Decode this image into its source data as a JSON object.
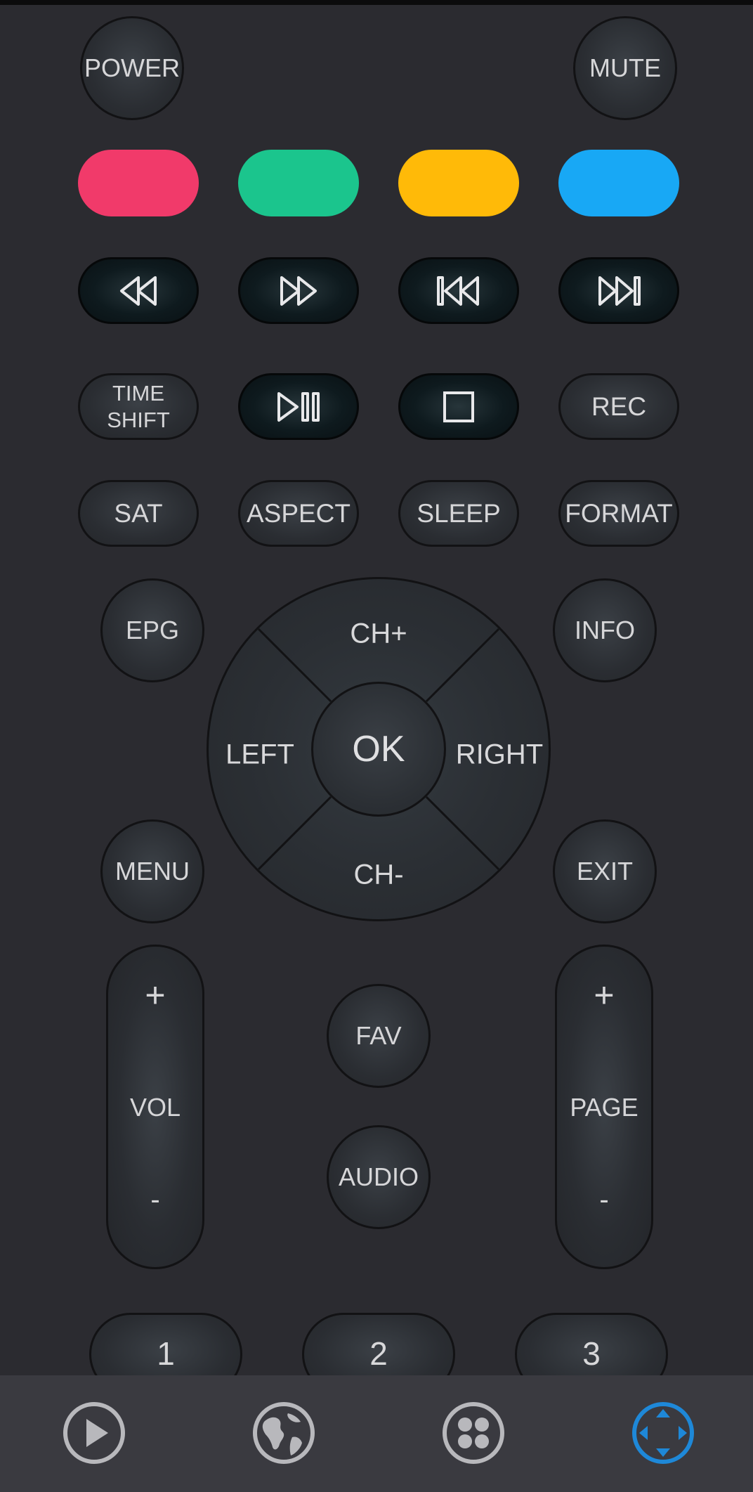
{
  "remote": {
    "power": "POWER",
    "mute": "MUTE",
    "colors": {
      "red": "#f13a6a",
      "green": "#1bc58d",
      "yellow": "#ffba08",
      "blue": "#18a8f5"
    },
    "row_transport": [
      "rewind-icon",
      "fast-forward-icon",
      "skip-previous-icon",
      "skip-next-icon"
    ],
    "timeshift": [
      "TIME",
      "SHIFT"
    ],
    "play_pause_icon": "play-pause-icon",
    "stop_icon": "stop-icon",
    "rec": "REC",
    "sat": "SAT",
    "aspect": "ASPECT",
    "sleep": "SLEEP",
    "format": "FORMAT",
    "epg": "EPG",
    "info": "INFO",
    "menu": "MENU",
    "exit": "EXIT",
    "dpad": {
      "up": "CH+",
      "down": "CH-",
      "left": "LEFT",
      "right": "RIGHT",
      "ok": "OK"
    },
    "vol": {
      "plus": "+",
      "label": "VOL",
      "minus": "-"
    },
    "page": {
      "plus": "+",
      "label": "PAGE",
      "minus": "-"
    },
    "fav": "FAV",
    "audio": "AUDIO",
    "numbers": [
      "1",
      "2",
      "3"
    ]
  },
  "navbar": {
    "items": [
      "play-icon",
      "globe-icon",
      "apps-icon",
      "dpad-icon"
    ],
    "active_color": "#1e88d8",
    "inactive_color": "#b8b8bc"
  }
}
